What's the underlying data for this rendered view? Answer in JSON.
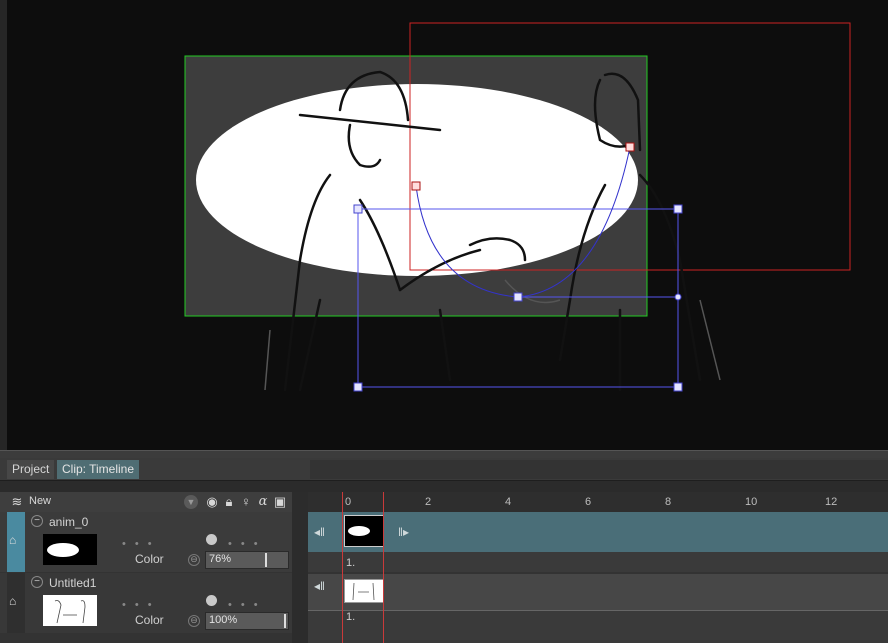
{
  "tabs": {
    "project": "Project",
    "clip": "Clip: Timeline"
  },
  "toolbar": {
    "new_label": "New",
    "icons": [
      "layers-icon",
      "chevron-down-icon",
      "eye-icon",
      "lock-icon",
      "bulb-icon",
      "alpha-icon",
      "grid-icon",
      "camera-icon"
    ]
  },
  "layers": [
    {
      "name": "anim_0",
      "color_label": "Color",
      "opacity": "76%",
      "opacity_fraction": 0.76,
      "frame_no": "1."
    },
    {
      "name": "Untitled1",
      "color_label": "Color",
      "opacity": "100%",
      "opacity_fraction": 1.0,
      "frame_no": "1."
    }
  ],
  "ruler": {
    "ticks": [
      "0",
      "2",
      "4",
      "6",
      "8",
      "10",
      "12"
    ]
  },
  "colors": {
    "camera_frame": "#22cc22",
    "target_frame": "#cc2222",
    "transform_box": "#5555ee",
    "track_selected": "#4a6e78",
    "layer_selected": "#4a8aa0"
  }
}
